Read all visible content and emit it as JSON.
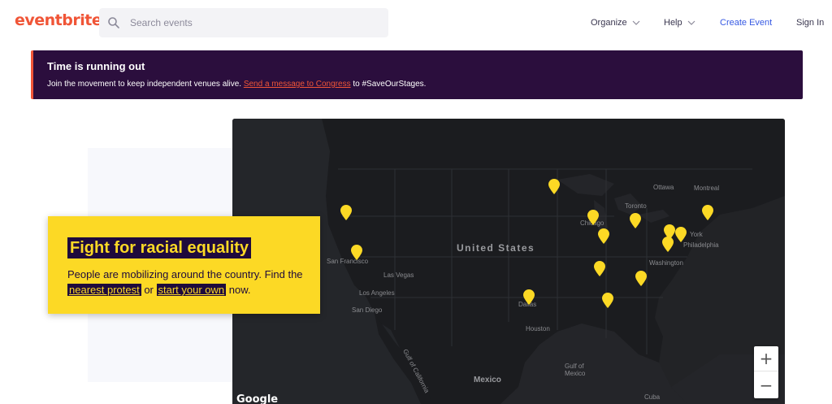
{
  "header": {
    "logo": "eventbrite",
    "search_placeholder": "Search events",
    "nav": {
      "organize": "Organize",
      "help": "Help",
      "create_event": "Create Event",
      "sign_in": "Sign In"
    }
  },
  "banner": {
    "title": "Time is running out",
    "text_before": "Join the movement to keep independent venues alive. ",
    "link": "Send a message to Congress",
    "text_after": " to #SaveOurStages."
  },
  "card": {
    "title": "Fight for racial equality",
    "text_before": "People are mobilizing around the country. Find the ",
    "link1": "nearest protest",
    "text_mid": " or ",
    "link2": "start your own",
    "text_after": " now."
  },
  "map": {
    "country_label": "United States",
    "labels": {
      "ottawa": "Ottawa",
      "montreal": "Montreal",
      "toronto": "Toronto",
      "chicago": "Chicago",
      "new_york": "York",
      "philadelphia": "Philadelphia",
      "washington": "Washington",
      "san_francisco": "San Francisco",
      "las_vegas": "Las Vegas",
      "los_angeles": "Los Angeles",
      "san_diego": "San Diego",
      "dallas": "Dallas",
      "houston": "Houston",
      "gulf_of_california": "Gulf of California",
      "gulf_of_mexico": "Gulf of Mexico",
      "mexico": "Mexico",
      "cuba": "Cuba"
    },
    "zoom_in": "+",
    "zoom_out": "−",
    "attribution": "Google",
    "pin_color": "#fcd925"
  },
  "colors": {
    "brand": "#f05537",
    "banner_bg": "#2b0e3d",
    "link_blue": "#3659e3",
    "card_bg": "#fcd925",
    "card_dark": "#1e0a3c"
  }
}
